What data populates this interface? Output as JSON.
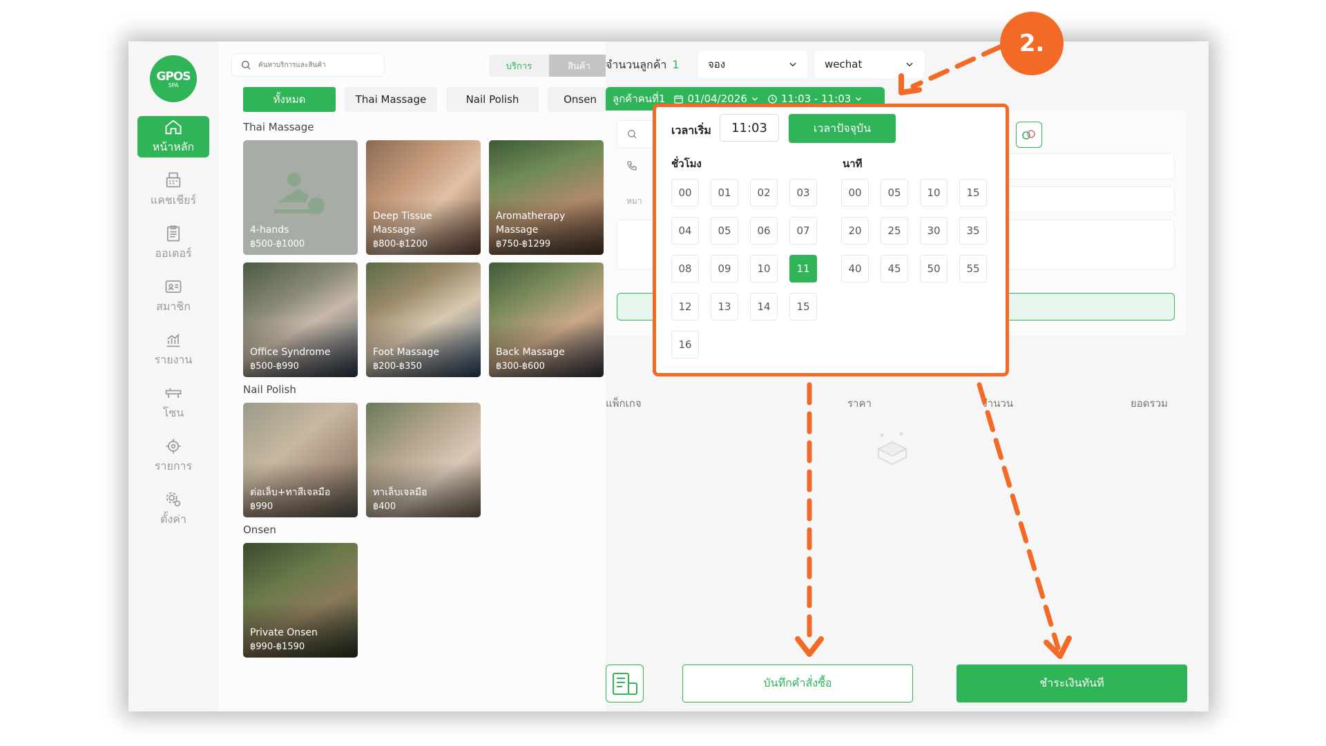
{
  "sidebar": {
    "logo": {
      "brand": "GPOS",
      "sub": "SPA"
    },
    "items": [
      {
        "label": "หน้าหลัก",
        "icon": "home-icon"
      },
      {
        "label": "แคชเชียร์",
        "icon": "cashier-icon"
      },
      {
        "label": "ออเดอร์",
        "icon": "clipboard-icon"
      },
      {
        "label": "สมาชิก",
        "icon": "member-card-icon"
      },
      {
        "label": "รายงาน",
        "icon": "chart-icon"
      },
      {
        "label": "โซน",
        "icon": "bed-icon"
      },
      {
        "label": "รายการ",
        "icon": "spa-icon"
      },
      {
        "label": "ตั้งค่า",
        "icon": "gear-icon"
      }
    ]
  },
  "search": {
    "placeholder": "ค้นหาบริการและสินค้า"
  },
  "segment": {
    "service": "บริการ",
    "product": "สินค้า"
  },
  "tabs": [
    "ทั้งหมด",
    "Thai Massage",
    "Nail Polish",
    "Onsen"
  ],
  "sections": {
    "thai": "Thai Massage",
    "nail": "Nail Polish",
    "onsen": "Onsen"
  },
  "cards": {
    "thai": [
      {
        "name": "4-hands",
        "price": "฿500-฿1000"
      },
      {
        "name": "Deep Tissue Massage",
        "price": "฿800-฿1200"
      },
      {
        "name": "Aromatherapy Massage",
        "price": "฿750-฿1299"
      },
      {
        "name": "Office Syndrome",
        "price": "฿500-฿990"
      },
      {
        "name": "Foot Massage",
        "price": "฿200-฿350"
      },
      {
        "name": "Back Massage",
        "price": "฿300-฿600"
      }
    ],
    "nail": [
      {
        "name": "ต่อเล็บ+ทาสีเจลมือ",
        "price": "฿990"
      },
      {
        "name": "ทาเล็บเจลมือ",
        "price": "฿400"
      }
    ],
    "onsen": [
      {
        "name": "Private Onsen",
        "price": "฿990-฿1590"
      }
    ]
  },
  "header": {
    "customer_count_label": "จำนวนลูกค้า",
    "customer_count": "1",
    "booking_select": "จอง",
    "channel_select": "wechat"
  },
  "customer_tag": {
    "label": "ลูกค้าคนที่1",
    "date": "01/04/2026",
    "time_range": "11:03 - 11:03"
  },
  "time_picker": {
    "start_label": "เวลาเริ่ม",
    "value": "11:03",
    "now_button": "เวลาปัจจุบัน",
    "hours_title": "ชั่วโมง",
    "minutes_title": "นาที",
    "hours": [
      "00",
      "01",
      "02",
      "03",
      "04",
      "05",
      "06",
      "07",
      "08",
      "09",
      "10",
      "11",
      "12",
      "13",
      "14",
      "15",
      "16"
    ],
    "selected_hour": "11",
    "minutes": [
      "00",
      "05",
      "10",
      "15",
      "20",
      "25",
      "30",
      "35",
      "40",
      "45",
      "50",
      "55"
    ]
  },
  "form": {
    "name_prefix": "หมา"
  },
  "table": {
    "package": "แพ็กเกจ",
    "price": "ราคา",
    "qty": "จำนวน",
    "total": "ยอดรวม"
  },
  "footer": {
    "save": "บันทึกคำสั่งซื้อ",
    "pay": "ชำระเงินทันที"
  },
  "annotation": {
    "step": "2."
  },
  "colors": {
    "accent": "#2fb457",
    "annotation": "#f26a25"
  }
}
